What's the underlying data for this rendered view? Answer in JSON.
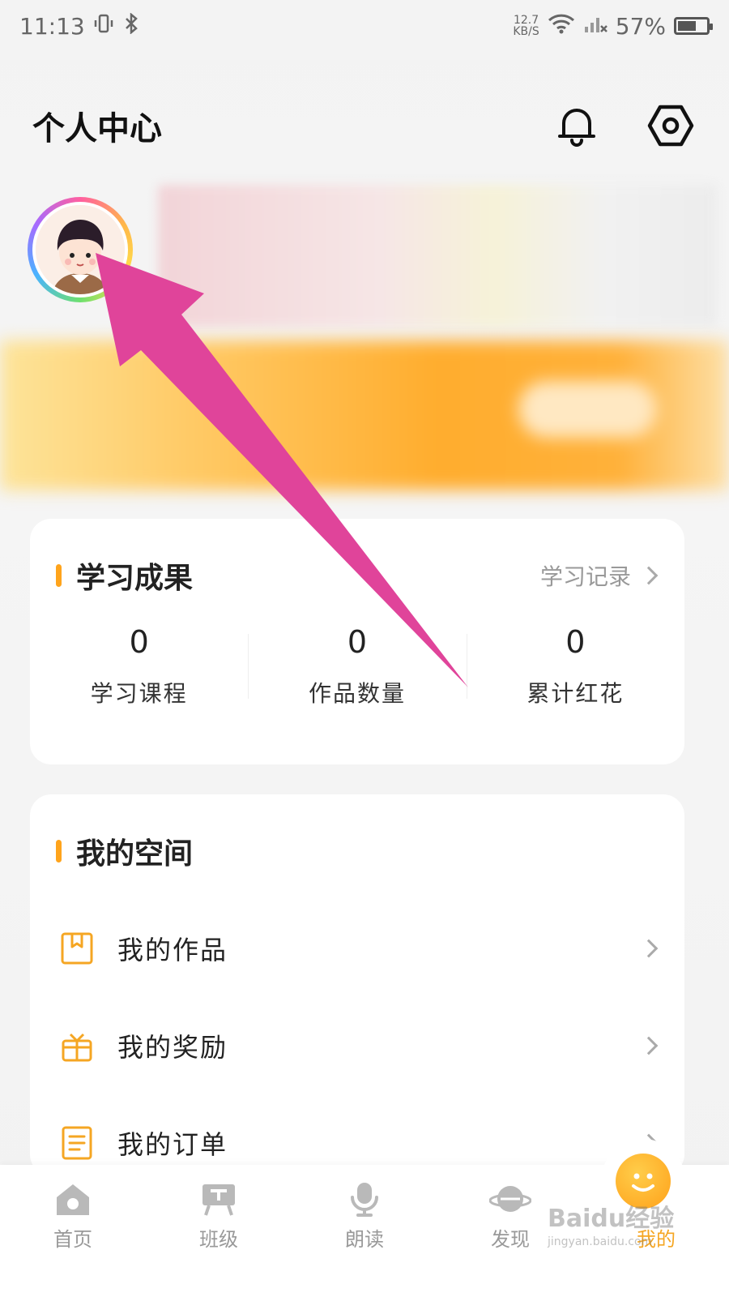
{
  "status_bar": {
    "time": "11:13",
    "net_speed_value": "12.7",
    "net_speed_unit": "KB/S",
    "battery": "57%",
    "battery_level": 0.57
  },
  "header": {
    "title": "个人中心",
    "notification_icon": "bell-icon",
    "settings_icon": "hexagon-settings-icon"
  },
  "learning_results": {
    "title": "学习成果",
    "record_link": "学习记录",
    "stats": [
      {
        "value": "0",
        "label": "学习课程"
      },
      {
        "value": "0",
        "label": "作品数量"
      },
      {
        "value": "0",
        "label": "累计红花"
      }
    ]
  },
  "my_space": {
    "title": "我的空间",
    "items": [
      {
        "label": "我的作品",
        "icon": "bookmark-book-icon"
      },
      {
        "label": "我的奖励",
        "icon": "gift-icon"
      },
      {
        "label": "我的订单",
        "icon": "order-list-icon"
      }
    ]
  },
  "bottom_nav": {
    "items": [
      {
        "label": "首页",
        "icon": "home-icon"
      },
      {
        "label": "班级",
        "icon": "class-board-icon"
      },
      {
        "label": "朗读",
        "icon": "microphone-icon"
      },
      {
        "label": "发现",
        "icon": "planet-icon"
      },
      {
        "label": "我的",
        "icon": "smiley-face-icon"
      }
    ],
    "active_index": 4
  },
  "watermark": {
    "text": "Baidu经验",
    "sub": "jingyan.baidu.com"
  },
  "colors": {
    "accent": "#f5a623",
    "annotation_arrow": "#e0449a"
  }
}
